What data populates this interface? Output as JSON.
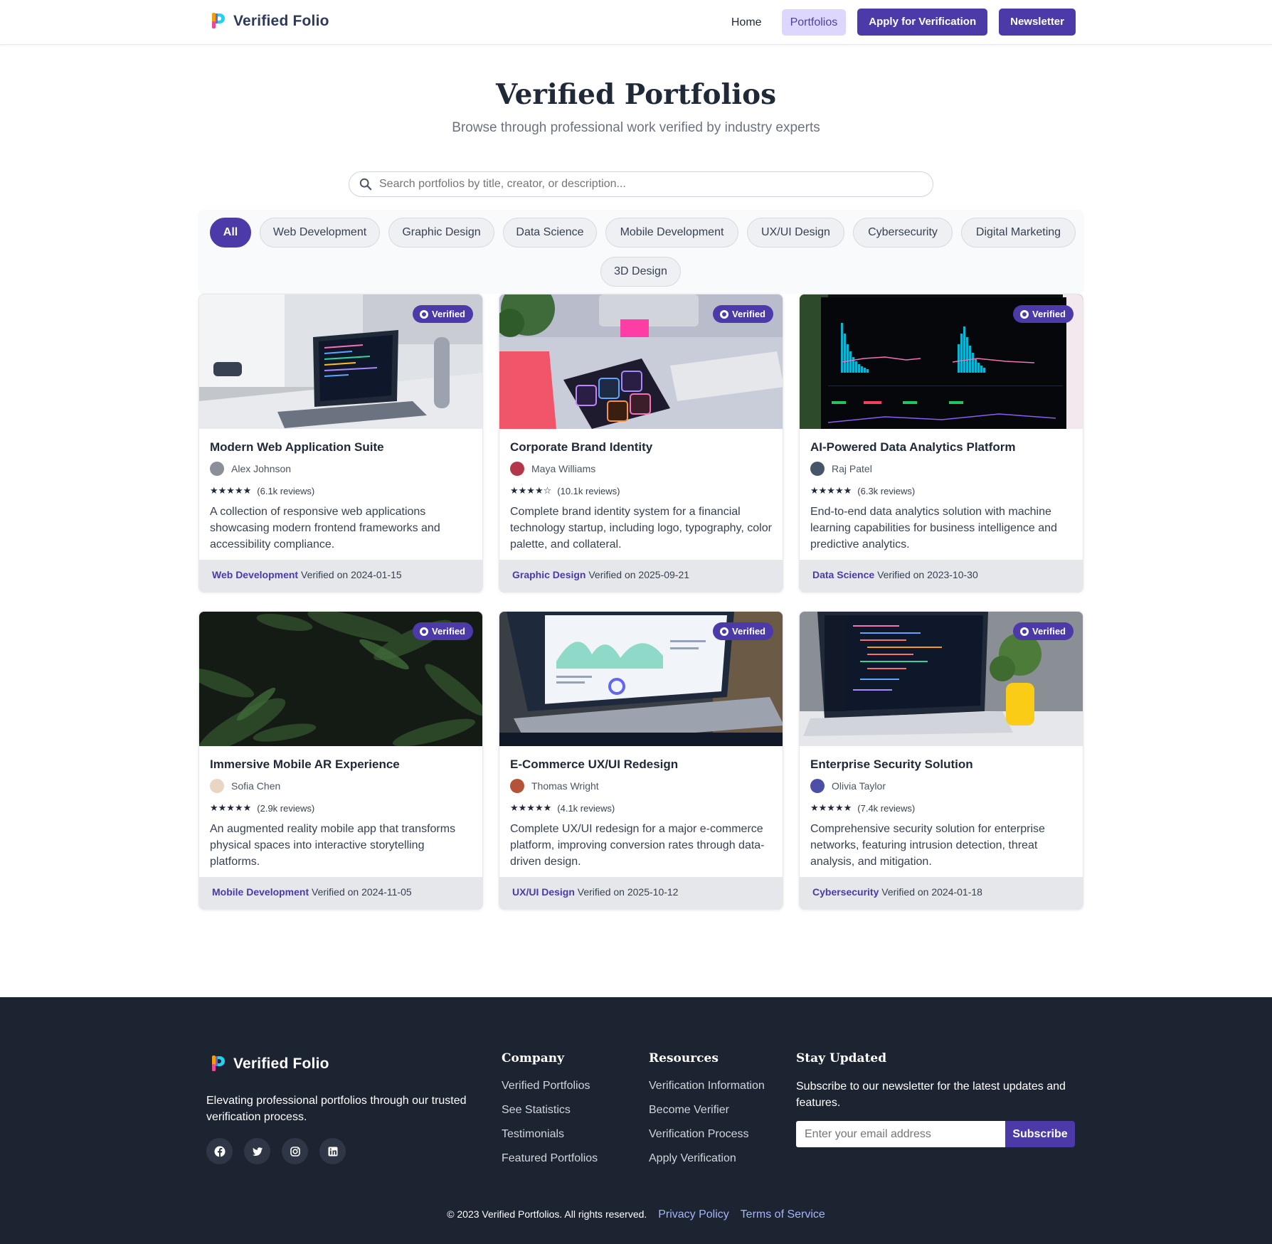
{
  "header": {
    "brand": "Verified Folio",
    "nav": {
      "home": "Home",
      "portfolios": "Portfolios",
      "apply": "Apply for Verification",
      "newsletter": "Newsletter"
    }
  },
  "hero": {
    "title": "Verified Portfolios",
    "subtitle": "Browse through professional work verified by industry experts"
  },
  "search": {
    "placeholder": "Search portfolios by title, creator, or description..."
  },
  "filters": [
    "All",
    "Web Development",
    "Graphic Design",
    "Data Science",
    "Mobile Development",
    "UX/UI Design",
    "Cybersecurity",
    "Digital Marketing",
    "3D Design"
  ],
  "badge_label": "Verified",
  "verified_prefix": "Verified on",
  "cards": [
    {
      "title": "Modern Web Application Suite",
      "author": "Alex Johnson",
      "stars": "★★★★★",
      "reviews": "(6.1k reviews)",
      "description": "A collection of responsive web applications showcasing modern frontend frameworks and accessibility compliance.",
      "category": "Web Development",
      "date": "2024-01-15"
    },
    {
      "title": "Corporate Brand Identity",
      "author": "Maya Williams",
      "stars": "★★★★☆",
      "reviews": "(10.1k reviews)",
      "description": "Complete brand identity system for a financial technology startup, including logo, typography, color palette, and collateral.",
      "category": "Graphic Design",
      "date": "2025-09-21"
    },
    {
      "title": "AI-Powered Data Analytics Platform",
      "author": "Raj Patel",
      "stars": "★★★★★",
      "reviews": "(6.3k reviews)",
      "description": "End-to-end data analytics solution with machine learning capabilities for business intelligence and predictive analytics.",
      "category": "Data Science",
      "date": "2023-10-30"
    },
    {
      "title": "Immersive Mobile AR Experience",
      "author": "Sofia Chen",
      "stars": "★★★★★",
      "reviews": "(2.9k reviews)",
      "description": "An augmented reality mobile app that transforms physical spaces into interactive storytelling platforms.",
      "category": "Mobile Development",
      "date": "2024-11-05"
    },
    {
      "title": "E-Commerce UX/UI Redesign",
      "author": "Thomas Wright",
      "stars": "★★★★★",
      "reviews": "(4.1k reviews)",
      "description": "Complete UX/UI redesign for a major e-commerce platform, improving conversion rates through data-driven design.",
      "category": "UX/UI Design",
      "date": "2025-10-12"
    },
    {
      "title": "Enterprise Security Solution",
      "author": "Olivia Taylor",
      "stars": "★★★★★",
      "reviews": "(7.4k reviews)",
      "description": "Comprehensive security solution for enterprise networks, featuring intrusion detection, threat analysis, and mitigation.",
      "category": "Cybersecurity",
      "date": "2024-01-18"
    }
  ],
  "footer": {
    "brand": "Verified Folio",
    "description": "Elevating professional portfolios through our trusted verification process.",
    "socials": [
      "facebook-icon",
      "twitter-icon",
      "instagram-icon",
      "linkedin-icon"
    ],
    "company": {
      "heading": "Company",
      "links": [
        "Verified Portfolios",
        "See Statistics",
        "Testimonials",
        "Featured Portfolios"
      ]
    },
    "resources": {
      "heading": "Resources",
      "links": [
        "Verification Information",
        "Become Verifier",
        "Verification Process",
        "Apply Verification"
      ]
    },
    "newsletter": {
      "heading": "Stay Updated",
      "text": "Subscribe to our newsletter for the latest updates and features.",
      "placeholder": "Enter your email address",
      "button": "Subscribe"
    },
    "copyright": "© 2023 Verified Portfolios. All rights reserved.",
    "privacy": "Privacy Policy",
    "terms": "Terms of Service"
  },
  "colors": {
    "accent": "#4b3aa8",
    "accent_light": "#ddd6fe",
    "footer_bg": "#1c2331"
  }
}
